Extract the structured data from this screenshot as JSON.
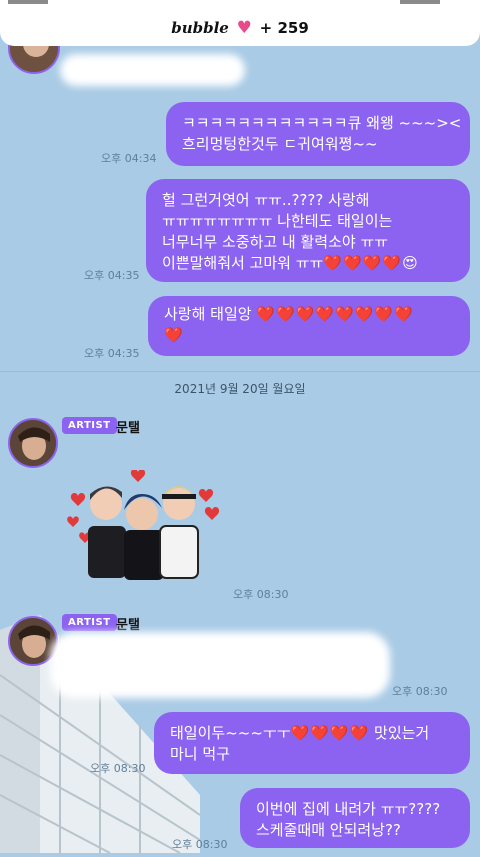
{
  "header": {
    "brand": "bubble",
    "heart_icon": "heart-icon",
    "count": "+ 259"
  },
  "messages_top": [
    {
      "lines": [
        "ㅋㅋㅋㅋㅋㅋㅋㅋㅋㅋㅋㅋ큐 왜왱 ~~~><",
        "흐리멍텅한것두 ㄷ귀여워쪙~~"
      ],
      "time": "오후 04:34"
    },
    {
      "lines": [
        "헐 그런거엿어 ㅠㅠ..???? 사랑해",
        "ㅠㅠㅠㅠㅠㅠㅠㅠ 나한테도 태일이는",
        "너무너무 소중하고 내 활력소야 ㅠㅠ",
        "이쁜말해줘서 고마워 ㅠㅠ"
      ],
      "hearts": "❤️❤️❤️❤️",
      "emoji": "😍",
      "time": "오후 04:35"
    },
    {
      "line1": "사랑해 태일앙",
      "hearts1": "❤️❤️❤️❤️❤️❤️❤️❤️",
      "hearts2": "❤️",
      "time": "오후 04:35"
    }
  ],
  "date_separator": "2021년 9월 20일 월요일",
  "artist": {
    "badge": "ARTIST",
    "name": "문탤"
  },
  "sticker_time": "오후 08:30",
  "blurred_time": "오후 08:30",
  "messages_bottom": [
    {
      "line1": "태일이두~~~ㅜㅜ",
      "hearts": "❤️❤️❤️❤️",
      "line1_end": "맛있는거",
      "line2": "마니 먹구",
      "time": "오후 08:30"
    },
    {
      "lines": [
        "이번에 집에 내려가 ㅠㅠ????",
        "스케줄때매 안되려낭??"
      ],
      "time": "오후 08:30"
    }
  ]
}
